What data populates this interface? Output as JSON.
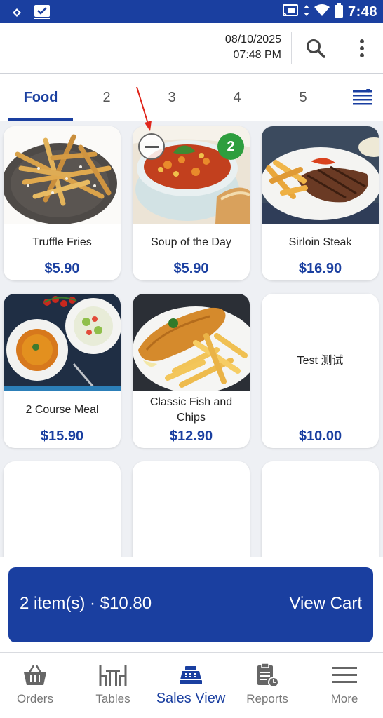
{
  "status_bar": {
    "time": "7:48"
  },
  "header": {
    "date": "08/10/2025",
    "time": "07:48 PM"
  },
  "tabs": [
    {
      "label": "Food"
    },
    {
      "label": "2"
    },
    {
      "label": "3"
    },
    {
      "label": "4"
    },
    {
      "label": "5"
    }
  ],
  "menu_items": [
    {
      "name": "Truffle Fries",
      "price": "$5.90"
    },
    {
      "name": "Soup of the Day",
      "price": "$5.90",
      "quantity": "2"
    },
    {
      "name": "Sirloin Steak",
      "price": "$16.90"
    },
    {
      "name": "2 Course Meal",
      "price": "$15.90"
    },
    {
      "name": "Classic Fish and Chips",
      "price": "$12.90"
    },
    {
      "name": "Test 测试",
      "price": "$10.00"
    }
  ],
  "cart": {
    "summary": "2 item(s) · $10.80",
    "action": "View Cart"
  },
  "bottom_nav": [
    {
      "label": "Orders"
    },
    {
      "label": "Tables"
    },
    {
      "label": "Sales View"
    },
    {
      "label": "Reports"
    },
    {
      "label": "More"
    }
  ],
  "colors": {
    "primary": "#1a3fa0",
    "badge": "#2e9e3e",
    "annotation_arrow": "#e0261c"
  }
}
